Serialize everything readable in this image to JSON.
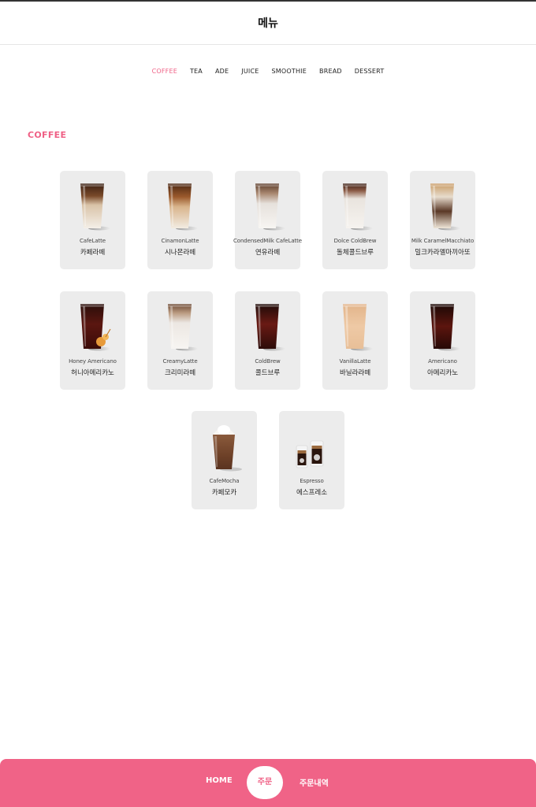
{
  "header": {
    "title": "메뉴"
  },
  "categories": [
    "COFFEE",
    "TEA",
    "ADE",
    "JUICE",
    "SMOOTHIE",
    "BREAD",
    "DESSERT"
  ],
  "active_category": "COFFEE",
  "section": {
    "title": "COFFEE"
  },
  "menu_items": [
    {
      "en": "CafeLatte",
      "ko": "카페라떼",
      "icon": "iced-latte-icon"
    },
    {
      "en": "CinamonLatte",
      "ko": "시나몬라떼",
      "icon": "iced-cinnamon-latte-icon"
    },
    {
      "en": "CondensedMilk CafeLatte",
      "ko": "연유라떼",
      "icon": "iced-condensed-milk-latte-icon"
    },
    {
      "en": "Dolce ColdBrew",
      "ko": "돌체콜드브루",
      "icon": "iced-dolce-coldbrew-icon"
    },
    {
      "en": "Milk CaramelMacchiato",
      "ko": "밀크카라멜마끼아또",
      "icon": "iced-caramel-macchiato-icon"
    },
    {
      "en": "Honey Americano",
      "ko": "허니아메리카노",
      "icon": "iced-honey-americano-icon"
    },
    {
      "en": "CreamyLatte",
      "ko": "크리미라떼",
      "icon": "iced-creamy-latte-icon"
    },
    {
      "en": "ColdBrew",
      "ko": "콜드브루",
      "icon": "iced-coldbrew-icon"
    },
    {
      "en": "VanillaLatte",
      "ko": "바닐라라떼",
      "icon": "iced-vanilla-latte-icon"
    },
    {
      "en": "Americano",
      "ko": "아메리카노",
      "icon": "iced-americano-icon"
    },
    {
      "en": "CafeMocha",
      "ko": "카페모카",
      "icon": "iced-mocha-icon"
    },
    {
      "en": "Espresso",
      "ko": "에스프레소",
      "icon": "espresso-shot-icon"
    }
  ],
  "bottom_nav": {
    "home": "HOME",
    "order": "주문",
    "history": "주문내역"
  },
  "colors": {
    "accent": "#ef6085",
    "card_bg": "#ececec",
    "bottom_bar": "#f06387"
  }
}
